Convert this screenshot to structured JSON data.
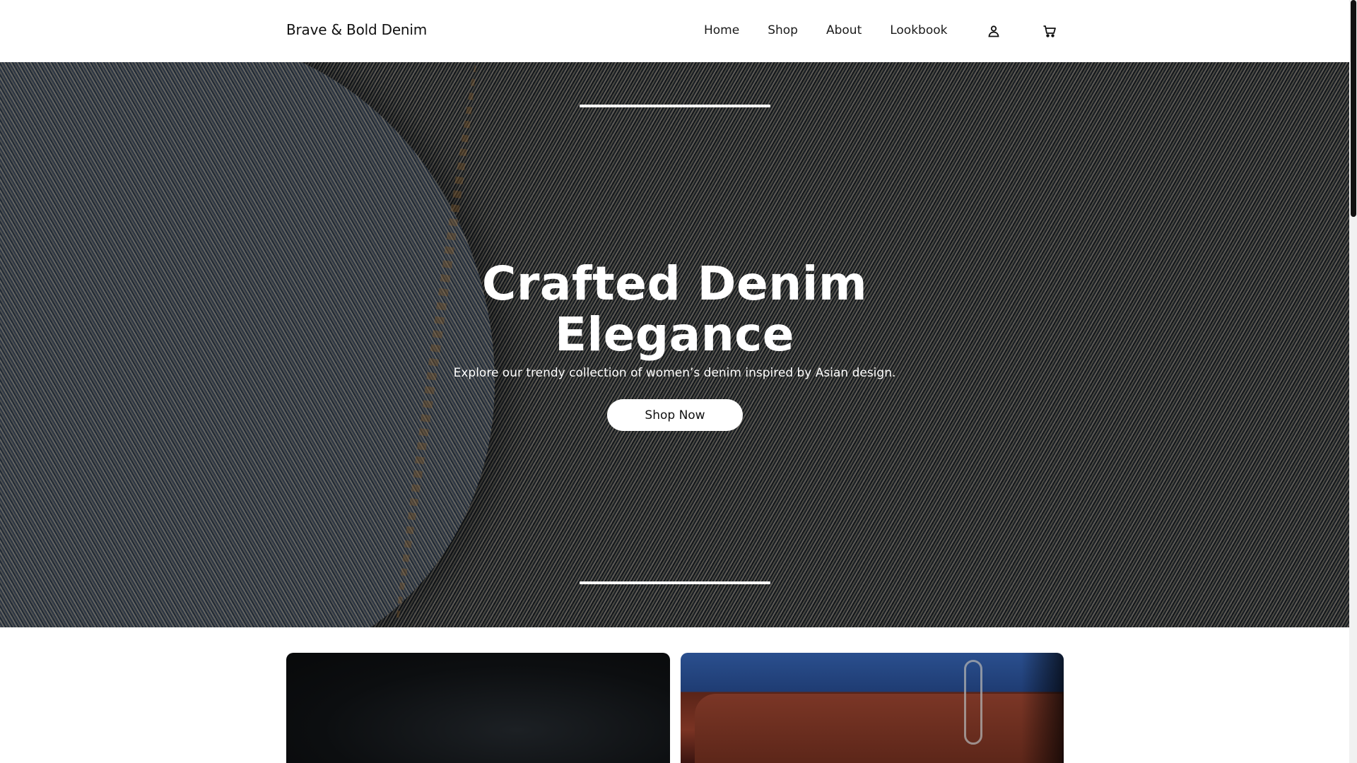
{
  "header": {
    "brand": "Brave & Bold Denim",
    "nav": [
      "Home",
      "Shop",
      "About",
      "Lookbook"
    ],
    "icons": {
      "account": "user-icon",
      "cart": "cart-icon"
    }
  },
  "hero": {
    "title_line1": "Crafted Denim",
    "title_line2": "Elegance",
    "subtitle": "Explore our trendy collection of women’s denim inspired by Asian design.",
    "cta": "Shop Now"
  },
  "colors": {
    "accent": "#ffffff",
    "text": "#111111",
    "overlay": "#000000"
  }
}
